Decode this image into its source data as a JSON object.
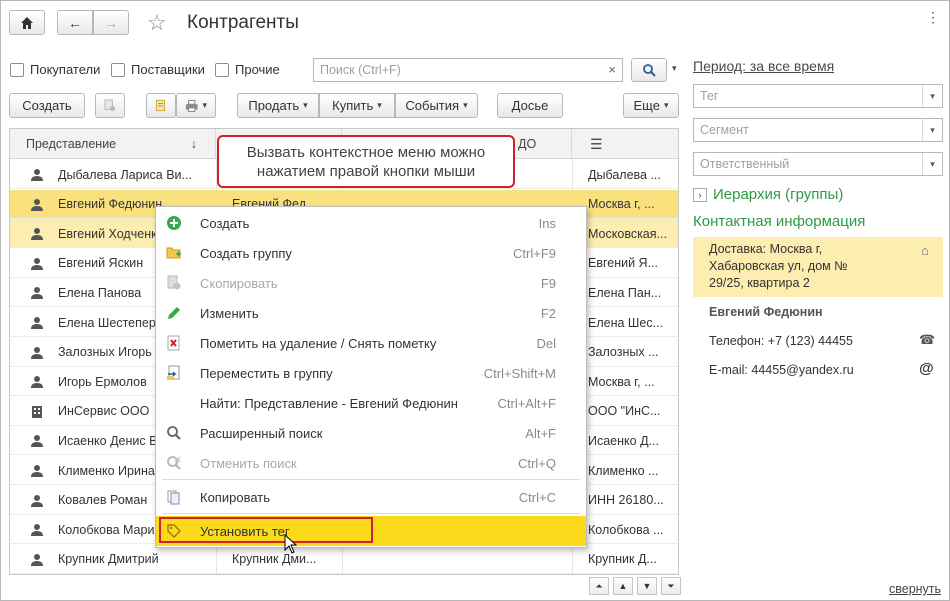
{
  "window": {
    "title": "Контрагенты"
  },
  "filters": {
    "checkboxes": [
      "Покупатели",
      "Поставщики",
      "Прочие"
    ],
    "search_placeholder": "Поиск (Ctrl+F)",
    "clear": "×"
  },
  "toolbar": {
    "create": "Создать",
    "sell": "Продать",
    "buy": "Купить",
    "events": "События",
    "dossier": "Досье",
    "more": "Еще"
  },
  "table": {
    "headers": [
      "Представление",
      "",
      "ДО",
      ""
    ],
    "sort_arrow": "↓",
    "rows": [
      {
        "name": "Дыбалева Лариса Ви...",
        "c2": "",
        "addr": "Дыбалева ...",
        "type": "person",
        "state": "none"
      },
      {
        "name": "Евгений Федюнин",
        "c2": "Евгений Фед...",
        "addr": "Москва г, ...",
        "type": "person",
        "state": "selected"
      },
      {
        "name": "Евгений Ходченко",
        "c2": "",
        "addr": "Московская...",
        "type": "person",
        "state": "highlight"
      },
      {
        "name": "Евгений Яскин",
        "c2": "",
        "addr": "Евгений Я...",
        "type": "person",
        "state": "none"
      },
      {
        "name": "Елена Панова",
        "c2": "",
        "addr": "Елена Пан...",
        "type": "person",
        "state": "none"
      },
      {
        "name": "Елена Шестеперова",
        "c2": "",
        "addr": "Елена Шес...",
        "type": "person",
        "state": "none"
      },
      {
        "name": "Залозных Игорь",
        "c2": "",
        "addr": "Залозных ...",
        "type": "person",
        "state": "none"
      },
      {
        "name": "Игорь Ермолов",
        "c2": "",
        "addr": "Москва г, ...",
        "type": "person",
        "state": "none"
      },
      {
        "name": "ИнСервис ООО",
        "c2": "",
        "addr": "ООО \"ИнС...",
        "type": "org",
        "state": "none"
      },
      {
        "name": "Исаенко Денис В",
        "c2": "",
        "addr": "Исаенко Д...",
        "type": "person",
        "state": "none"
      },
      {
        "name": "Клименко Ирина",
        "c2": "",
        "addr": "Клименко ...",
        "type": "person",
        "state": "none"
      },
      {
        "name": "Ковалев Роман",
        "c2": "",
        "addr": "ИНН 26180...",
        "type": "person",
        "state": "none"
      },
      {
        "name": "Колобкова Мария",
        "c2": "",
        "addr": "Колобкова ...",
        "type": "person",
        "state": "none"
      },
      {
        "name": "Крупник Дмитрий",
        "c2": "Крупник Дми...",
        "addr": "Крупник Д...",
        "type": "person",
        "state": "none"
      }
    ]
  },
  "tooltip": {
    "line1": "Вызвать контекстное меню можно",
    "line2": "нажатием правой кнопки мыши"
  },
  "context_menu": {
    "items": [
      {
        "label": "Создать",
        "shortcut": "Ins",
        "icon": "add-icon",
        "disabled": false
      },
      {
        "label": "Создать группу",
        "shortcut": "Ctrl+F9",
        "icon": "folder-add-icon",
        "disabled": false
      },
      {
        "label": "Скопировать",
        "shortcut": "F9",
        "icon": "copy-item-icon",
        "disabled": true
      },
      {
        "label": "Изменить",
        "shortcut": "F2",
        "icon": "edit-icon",
        "disabled": false
      },
      {
        "label": "Пометить на удаление / Снять пометку",
        "shortcut": "Del",
        "icon": "delete-mark-icon",
        "disabled": false
      },
      {
        "label": "Переместить в группу",
        "shortcut": "Ctrl+Shift+M",
        "icon": "move-to-group-icon",
        "disabled": false
      },
      {
        "label": "Найти: Представление - Евгений Федюнин",
        "shortcut": "Ctrl+Alt+F",
        "icon": "",
        "disabled": false
      },
      {
        "label": "Расширенный поиск",
        "shortcut": "Alt+F",
        "icon": "search-icon",
        "disabled": false
      },
      {
        "label": "Отменить поиск",
        "shortcut": "Ctrl+Q",
        "icon": "cancel-search-icon",
        "disabled": true
      },
      {
        "label": "Копировать",
        "shortcut": "Ctrl+C",
        "icon": "clipboard-copy-icon",
        "disabled": false
      },
      {
        "label": "Установить тег",
        "shortcut": "",
        "icon": "tag-icon",
        "disabled": false
      }
    ]
  },
  "right_panel": {
    "period": "Период: за все время",
    "tag_placeholder": "Тег",
    "segment_placeholder": "Сегмент",
    "responsible_placeholder": "Ответственный",
    "hierarchy": "Иерархия (группы)",
    "contact_title": "Контактная информация",
    "delivery_line1": "Доставка: Москва г,",
    "delivery_line2": "Хабаровская ул, дом №",
    "delivery_line3": "29/25, квартира 2",
    "person_name": "Евгений Федюнин",
    "phone": "Телефон: +7 (123) 44455",
    "email": "E-mail: 44455@yandex.ru",
    "collapse": "свернуть"
  },
  "colors": {
    "selection": "#f9e27e",
    "menu_active": "#fbd91b",
    "accent_red": "#d0202a",
    "green": "#2e9a43"
  }
}
